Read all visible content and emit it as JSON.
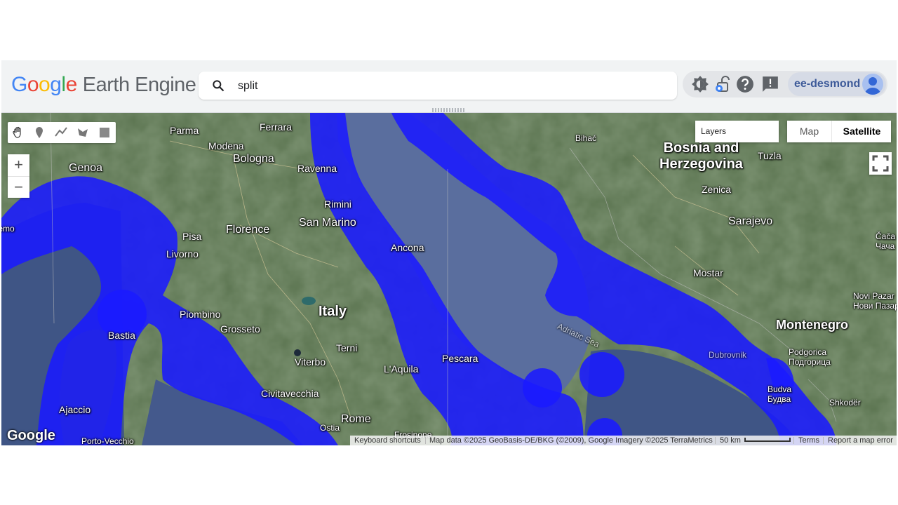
{
  "header": {
    "logo_google": [
      "G",
      "o",
      "o",
      "g",
      "l",
      "e"
    ],
    "product_name": "Earth Engine",
    "search_value": "split",
    "username": "ee-desmond",
    "icons": [
      "brightness-icon",
      "unlock-icon",
      "help-icon",
      "feedback-icon",
      "avatar"
    ]
  },
  "map": {
    "tools": [
      "pan-hand-icon",
      "marker-icon",
      "line-icon",
      "polygon-icon",
      "rectangle-icon"
    ],
    "zoom_in": "+",
    "zoom_out": "−",
    "layers_label": "Layers",
    "map_type_options": [
      "Map",
      "Satellite"
    ],
    "map_type_selected": "Satellite",
    "google_logo": "Google",
    "place_labels": [
      {
        "id": "parma",
        "text": "Parma"
      },
      {
        "id": "ferrara",
        "text": "Ferrara"
      },
      {
        "id": "modena",
        "text": "Modena"
      },
      {
        "id": "bologna",
        "text": "Bologna"
      },
      {
        "id": "ravenna",
        "text": "Ravenna"
      },
      {
        "id": "genoa",
        "text": "Genoa"
      },
      {
        "id": "pisa",
        "text": "Pisa"
      },
      {
        "id": "livorno",
        "text": "Livorno"
      },
      {
        "id": "florence",
        "text": "Florence"
      },
      {
        "id": "sanmarino",
        "text": "San Marino"
      },
      {
        "id": "rimini",
        "text": "Rimini"
      },
      {
        "id": "ancona",
        "text": "Ancona"
      },
      {
        "id": "italy",
        "text": "Italy"
      },
      {
        "id": "piombino",
        "text": "Piombino"
      },
      {
        "id": "grosseto",
        "text": "Grosseto"
      },
      {
        "id": "bastia",
        "text": "Bastia"
      },
      {
        "id": "terni",
        "text": "Terni"
      },
      {
        "id": "viterbo",
        "text": "Viterbo"
      },
      {
        "id": "laquila",
        "text": "L'Aquila"
      },
      {
        "id": "pescara",
        "text": "Pescara"
      },
      {
        "id": "civitavecchia",
        "text": "Civitavecchia"
      },
      {
        "id": "rome",
        "text": "Rome"
      },
      {
        "id": "ostia",
        "text": "Ostia"
      },
      {
        "id": "frosinone",
        "text": "Frosinone"
      },
      {
        "id": "ajaccio",
        "text": "Ajaccio"
      },
      {
        "id": "portovecchio",
        "text": "Porto-Vecchio"
      },
      {
        "id": "bihac",
        "text": "Bihać"
      },
      {
        "id": "bosnia",
        "text": "Bosnia and\nHerzegovina"
      },
      {
        "id": "tuzla",
        "text": "Tuzla"
      },
      {
        "id": "zenica",
        "text": "Zenica"
      },
      {
        "id": "sarajevo",
        "text": "Sarajevo"
      },
      {
        "id": "mostar",
        "text": "Mostar"
      },
      {
        "id": "montenegro",
        "text": "Montenegro"
      },
      {
        "id": "novipazar",
        "text": "Novi Pazar\nНови Пазар"
      },
      {
        "id": "cacak",
        "text": "Čača\nЧача"
      },
      {
        "id": "podgorica",
        "text": "Podgorica\nПодгорица"
      },
      {
        "id": "budva",
        "text": "Budva\nБудва"
      },
      {
        "id": "shkoder",
        "text": "Shkodër"
      },
      {
        "id": "dubrovnik",
        "text": "Dubrovnik"
      },
      {
        "id": "adriatic",
        "text": "Adriatic Sea"
      },
      {
        "id": "remo",
        "text": "Sanremo"
      }
    ],
    "attribution": {
      "shortcuts": "Keyboard shortcuts",
      "map_data": "Map data ©2025 GeoBasis-DE/BKG (©2009), Google Imagery ©2025 TerraMetrics",
      "scale": "50 km",
      "terms": "Terms",
      "report": "Report a map error"
    },
    "colors": {
      "overlay": "#1a1aff",
      "sea": "#4a5f95",
      "land": "#5b7450"
    }
  }
}
